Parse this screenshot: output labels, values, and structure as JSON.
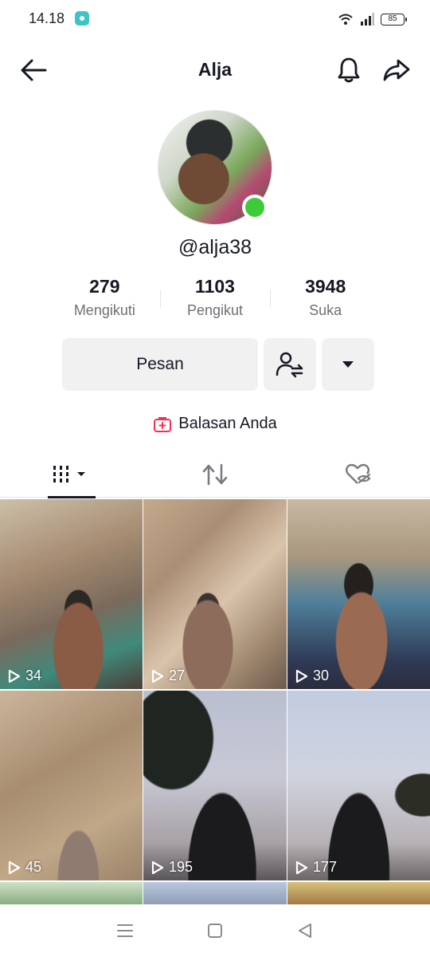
{
  "status_bar": {
    "time": "14.18",
    "battery": "85"
  },
  "header": {
    "title": "Alja"
  },
  "profile": {
    "username": "@alja38"
  },
  "stats": [
    {
      "value": "279",
      "label": "Mengikuti"
    },
    {
      "value": "1103",
      "label": "Pengikut"
    },
    {
      "value": "3948",
      "label": "Suka"
    }
  ],
  "actions": {
    "message_label": "Pesan"
  },
  "replies_label": "Balasan Anda",
  "videos": [
    {
      "views": "34"
    },
    {
      "views": "27"
    },
    {
      "views": "30"
    },
    {
      "views": "45"
    },
    {
      "views": "195"
    },
    {
      "views": "177"
    }
  ],
  "colors": {
    "online": "#3ecb3a",
    "accent": "#fe2c55",
    "text": "#161823"
  },
  "icons": [
    "back-arrow-icon",
    "bell-icon",
    "share-icon",
    "add-friend-icon",
    "dropdown-icon",
    "grid-icon",
    "repost-icon",
    "liked-hidden-icon",
    "play-icon",
    "menu-icon",
    "home-square-icon",
    "back-triangle-icon"
  ]
}
